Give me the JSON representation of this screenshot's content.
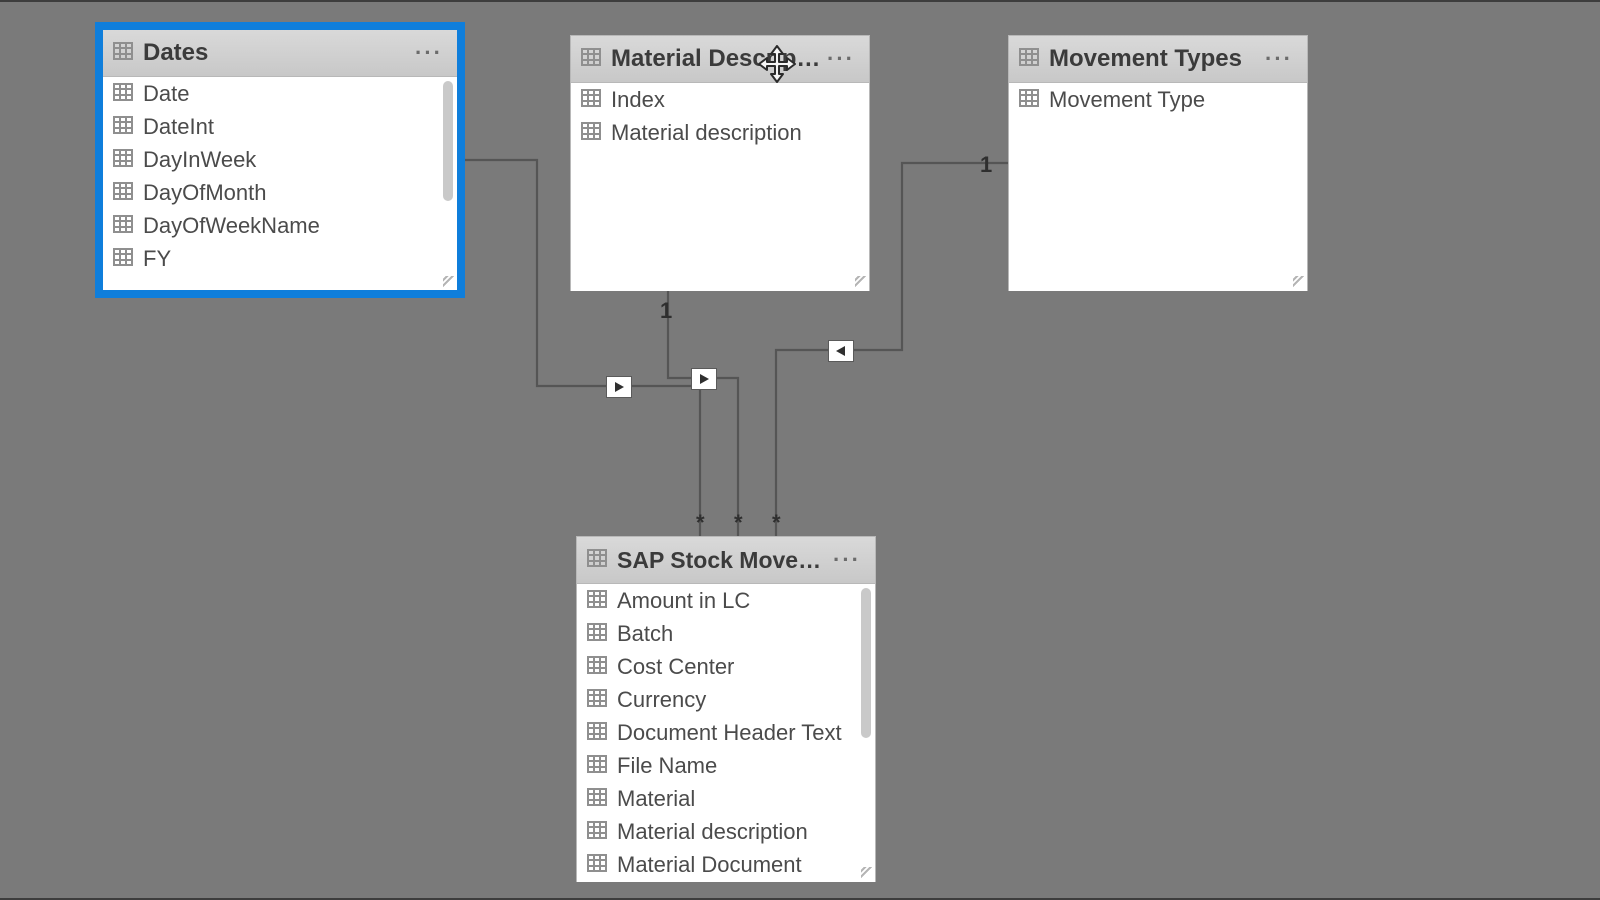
{
  "tables": {
    "dates": {
      "title": "Dates",
      "fields": [
        "Date",
        "DateInt",
        "DayInWeek",
        "DayOfMonth",
        "DayOfWeekName",
        "FY"
      ],
      "selected": true
    },
    "material": {
      "title": "Material Description",
      "fields": [
        "Index",
        "Material description"
      ]
    },
    "movement": {
      "title": "Movement Types",
      "fields": [
        "Movement Type"
      ]
    },
    "sap": {
      "title": "SAP Stock Movements",
      "fields": [
        "Amount in LC",
        "Batch",
        "Cost Center",
        "Currency",
        "Document Header Text",
        "File Name",
        "Material",
        "Material description",
        "Material Document"
      ]
    }
  },
  "cardinality": {
    "material_one": "1",
    "movement_one": "1",
    "sap_many_left": "*",
    "sap_many_mid": "*",
    "sap_many_right": "*"
  },
  "menu_label": "···"
}
